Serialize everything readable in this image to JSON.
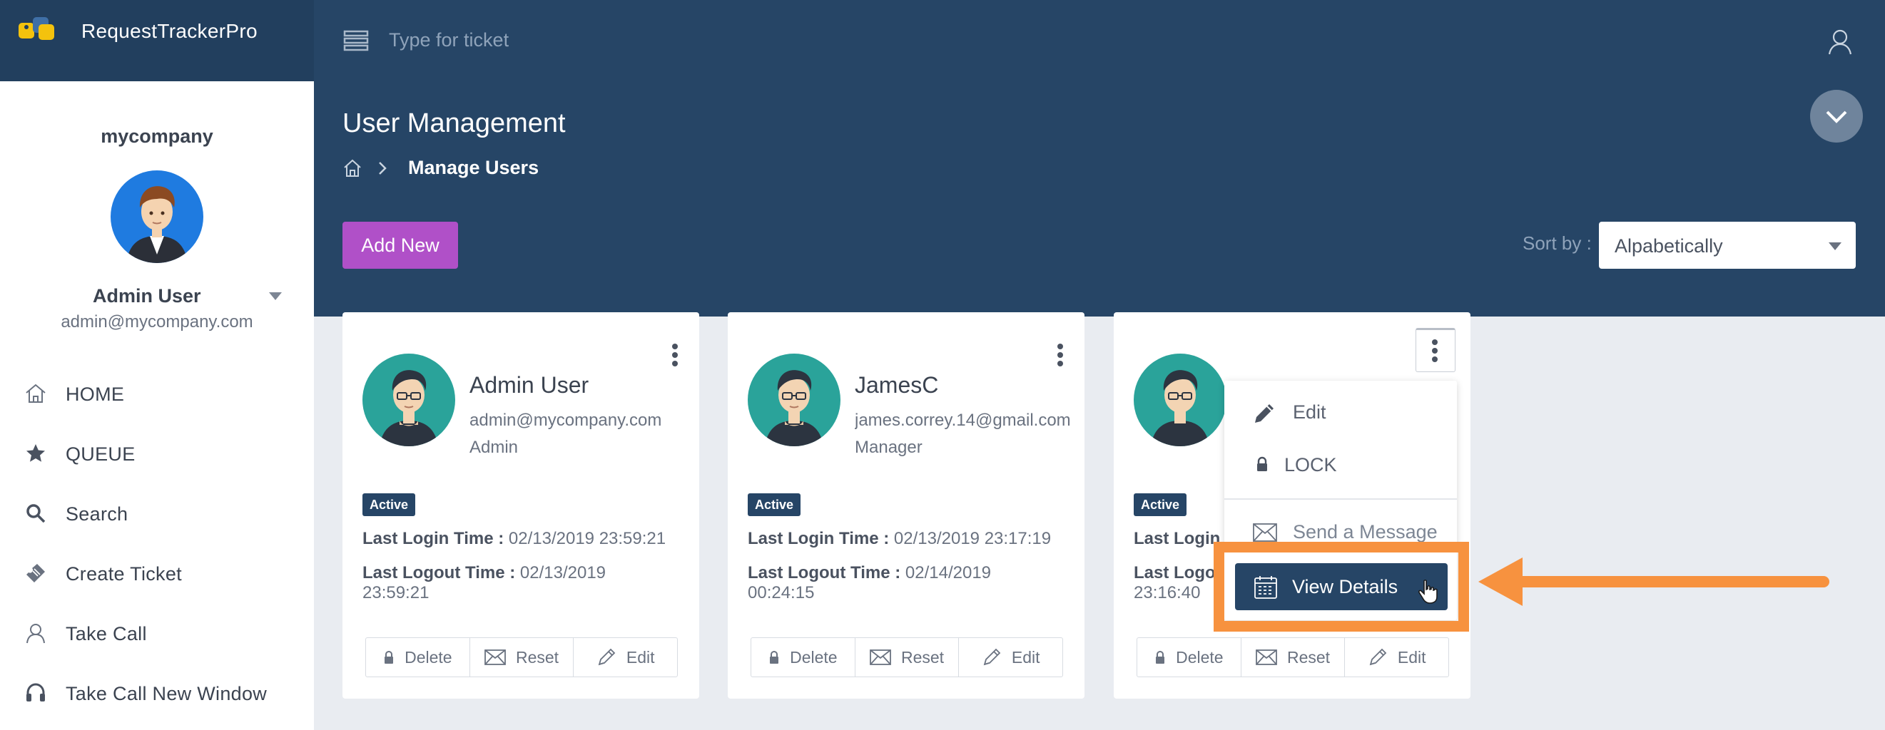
{
  "app": {
    "name": "RequestTrackerPro"
  },
  "topbar": {
    "search_placeholder": "Type for ticket"
  },
  "page": {
    "title": "User Management",
    "breadcrumb_current": "Manage Users",
    "add_label": "Add New",
    "sort_label": "Sort by :",
    "sort_value": "Alpabetically"
  },
  "sidebar": {
    "org": "mycompany",
    "user_name": "Admin User",
    "user_email": "admin@mycompany.com",
    "nav": [
      {
        "label": "HOME",
        "icon": "home-icon"
      },
      {
        "label": "QUEUE",
        "icon": "star-icon"
      },
      {
        "label": "Search",
        "icon": "search-icon"
      },
      {
        "label": "Create Ticket",
        "icon": "ticket-icon"
      },
      {
        "label": "Take Call",
        "icon": "user-icon"
      },
      {
        "label": "Take Call New Window",
        "icon": "headset-icon"
      }
    ]
  },
  "cards": [
    {
      "name": "Admin User",
      "email": "admin@mycompany.com",
      "role": "Admin",
      "status": "Active",
      "login_label": "Last Login Time :",
      "login_value": "02/13/2019 23:59:21",
      "logout_label": "Last Logout Time :",
      "logout_value": "02/13/2019 23:59:21",
      "actions": {
        "delete": "Delete",
        "reset": "Reset",
        "edit": "Edit"
      }
    },
    {
      "name": "JamesC",
      "email": "james.correy.14@gmail.com",
      "role": "Manager",
      "status": "Active",
      "login_label": "Last Login Time :",
      "login_value": "02/13/2019 23:17:19",
      "logout_label": "Last Logout Time :",
      "logout_value": "02/14/2019 00:24:15",
      "actions": {
        "delete": "Delete",
        "reset": "Reset",
        "edit": "Edit"
      }
    },
    {
      "status": "Active",
      "login_label_partial": "Last Login :",
      "logout_label_partial": "Last Logo",
      "logout_value_partial": "23:16:40",
      "actions": {
        "delete": "Delete",
        "reset": "Reset",
        "edit": "Edit"
      }
    }
  ],
  "dropdown": {
    "items": [
      {
        "label": "Edit",
        "icon": "pencil-icon"
      },
      {
        "label": "LOCK",
        "icon": "lock-icon"
      },
      {
        "label": "Send a Message",
        "icon": "envelope-icon"
      },
      {
        "label": "View Details",
        "icon": "calendar-icon"
      }
    ]
  },
  "colors": {
    "header": "#264566",
    "brand_panel": "#223f5e",
    "add_button": "#b050c8",
    "badge": "#264566",
    "highlight": "#f7923f",
    "avatar_bg": "#2aa39a",
    "sidebar_avatar_bg": "#1f7be0"
  }
}
